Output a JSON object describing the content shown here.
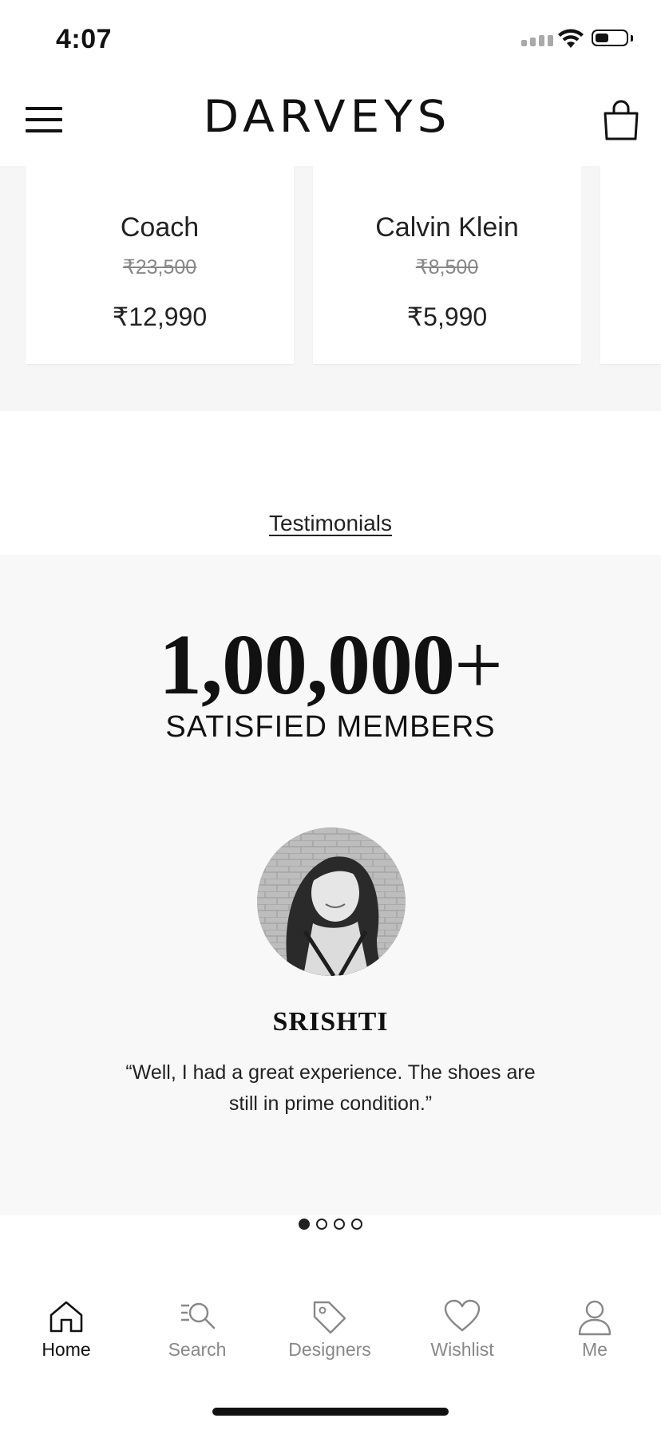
{
  "status_bar": {
    "time": "4:07",
    "battery_level": 0.45
  },
  "header": {
    "logo": "DARVEYS",
    "menu_icon": "hamburger-menu-icon",
    "cart_icon": "shopping-bag-icon"
  },
  "products": [
    {
      "brand": "Coach",
      "original_price": "₹23,500",
      "price": "₹12,990"
    },
    {
      "brand": "Calvin Klein",
      "original_price": "₹8,500",
      "price": "₹5,990"
    }
  ],
  "testimonials": {
    "link_label": "Testimonials",
    "stat_number": "1,00,000",
    "stat_suffix": "+",
    "stat_label": "SATISFIED MEMBERS",
    "name": "SRISHTI",
    "quote": "“Well, I had a great experience. The shoes are still in prime condition.”",
    "slide_count": 4,
    "active_slide": 1
  },
  "tab_bar": {
    "items": [
      {
        "label": "Home",
        "icon": "home-icon",
        "active": true
      },
      {
        "label": "Search",
        "icon": "search-icon",
        "active": false
      },
      {
        "label": "Designers",
        "icon": "tag-icon",
        "active": false
      },
      {
        "label": "Wishlist",
        "icon": "heart-icon",
        "active": false
      },
      {
        "label": "Me",
        "icon": "user-icon",
        "active": false
      }
    ]
  },
  "colors": {
    "text": "#111111",
    "muted": "#888888",
    "panel_bg": "#f8f8f8",
    "strip_bg": "#f6f6f6"
  }
}
